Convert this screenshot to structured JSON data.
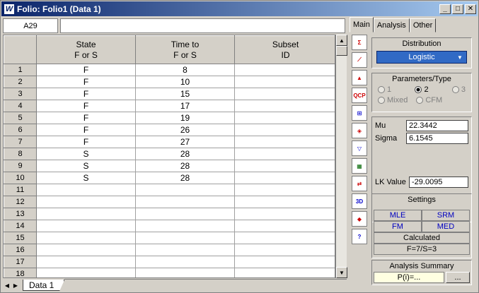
{
  "window": {
    "title": "Folio: Folio1 (Data 1)",
    "app_icon_letter": "W",
    "buttons": {
      "minimize": "_",
      "maximize": "□",
      "close": "✕"
    }
  },
  "cell_ref": "A29",
  "sheet": {
    "columns": [
      {
        "line1": "State",
        "line2": "F or S"
      },
      {
        "line1": "Time to",
        "line2": "F or S"
      },
      {
        "line1": "Subset",
        "line2": "ID"
      }
    ],
    "rows": [
      {
        "n": "1",
        "state": "F",
        "time": "8",
        "subset": ""
      },
      {
        "n": "2",
        "state": "F",
        "time": "10",
        "subset": ""
      },
      {
        "n": "3",
        "state": "F",
        "time": "15",
        "subset": ""
      },
      {
        "n": "4",
        "state": "F",
        "time": "17",
        "subset": ""
      },
      {
        "n": "5",
        "state": "F",
        "time": "19",
        "subset": ""
      },
      {
        "n": "6",
        "state": "F",
        "time": "26",
        "subset": ""
      },
      {
        "n": "7",
        "state": "F",
        "time": "27",
        "subset": ""
      },
      {
        "n": "8",
        "state": "S",
        "time": "28",
        "subset": ""
      },
      {
        "n": "9",
        "state": "S",
        "time": "28",
        "subset": ""
      },
      {
        "n": "10",
        "state": "S",
        "time": "28",
        "subset": ""
      },
      {
        "n": "11",
        "state": "",
        "time": "",
        "subset": ""
      },
      {
        "n": "12",
        "state": "",
        "time": "",
        "subset": ""
      },
      {
        "n": "13",
        "state": "",
        "time": "",
        "subset": ""
      },
      {
        "n": "14",
        "state": "",
        "time": "",
        "subset": ""
      },
      {
        "n": "15",
        "state": "",
        "time": "",
        "subset": ""
      },
      {
        "n": "16",
        "state": "",
        "time": "",
        "subset": ""
      },
      {
        "n": "17",
        "state": "",
        "time": "",
        "subset": ""
      },
      {
        "n": "18",
        "state": "",
        "time": "",
        "subset": ""
      }
    ],
    "tab_label": "Data 1"
  },
  "toolbar_icons": [
    "calculate-icon",
    "plot-icon",
    "quick-plot-icon",
    "qcp-icon",
    "grid-icon",
    "diamond-icon",
    "filter-icon",
    "table-icon",
    "transfer-icon",
    "3d-plot-icon",
    "tag-icon",
    "help-icon"
  ],
  "right_panel": {
    "tabs": [
      "Main",
      "Analysis",
      "Other"
    ],
    "distribution": {
      "title": "Distribution",
      "selected": "Logistic"
    },
    "params": {
      "title": "Parameters/Type",
      "options_row1": [
        "1",
        "2",
        "3"
      ],
      "options_row2": [
        "Mixed",
        "CFM"
      ],
      "selected": "2"
    },
    "mu_label": "Mu",
    "mu_value": "22.3442",
    "sigma_label": "Sigma",
    "sigma_value": "6.1545",
    "lk_label": "LK Value",
    "lk_value": "-29.0095",
    "settings": {
      "title": "Settings",
      "items": [
        "MLE",
        "SRM",
        "FM",
        "MED"
      ],
      "calculated_label": "Calculated",
      "calculated_value": "F=7/S=3"
    },
    "summary": {
      "title": "Analysis Summary",
      "value": "P(i)=...",
      "button": "..."
    }
  }
}
